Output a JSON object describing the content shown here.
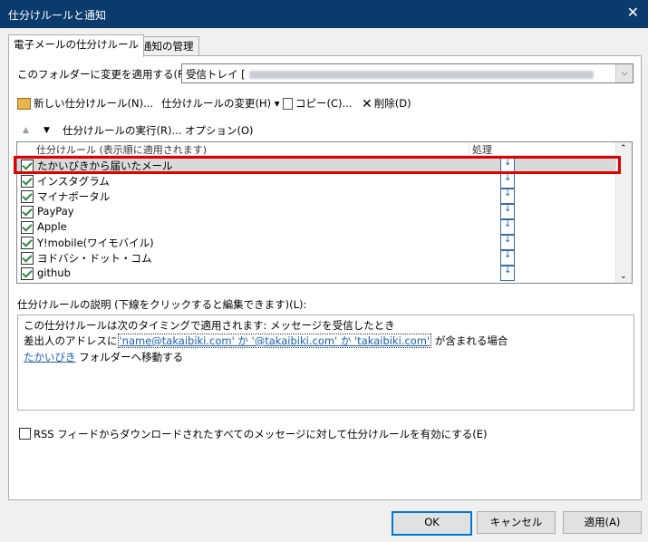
{
  "window": {
    "title": "仕分けルールと通知",
    "close_glyph": "✕"
  },
  "tabs": [
    {
      "label": "電子メールの仕分けルール"
    },
    {
      "label": "通知の管理"
    }
  ],
  "apply_to": {
    "label": "このフォルダーに変更を適用する(F):",
    "value": "受信トレイ [",
    "dropdown_glyph": "⌵"
  },
  "toolbar": {
    "new_rule": "新しい仕分けルール(N)...",
    "change_rule": "仕分けルールの変更(H)",
    "change_rule_glyph": "▾",
    "copy": "コピー(C)...",
    "delete": "削除(D)",
    "up_glyph": "▲",
    "down_glyph": "▼",
    "run_rules": "仕分けルールの実行(R)...",
    "options": "オプション(O)"
  },
  "rules_list": {
    "col_rule": "仕分けルール (表示順に適用されます)",
    "col_action": "処理",
    "rows": [
      {
        "name": "たかいびきから届いたメール"
      },
      {
        "name": "インスタグラム"
      },
      {
        "name": "マイナポータル"
      },
      {
        "name": "PayPay"
      },
      {
        "name": "Apple"
      },
      {
        "name": "Y!mobile(ワイモバイル)"
      },
      {
        "name": "ヨドバシ・ドット・コム"
      },
      {
        "name": "github"
      }
    ],
    "scroll_up_glyph": "⌃",
    "scroll_down_glyph": "⌄"
  },
  "description": {
    "label": "仕分けルールの説明 (下線をクリックすると編集できます)(L):",
    "line1": "この仕分けルールは次のタイミングで適用されます: メッセージを受信したとき",
    "line2_prefix": "差出人のアドレスに",
    "line2_link": "'name@takaibiki.com' か '@takaibiki.com' か 'takaibiki.com'",
    "line2_suffix": "が含まれる場合",
    "line3_link": "たかいびき",
    "line3_suffix": "フォルダーへ移動する"
  },
  "rss_option": {
    "label": "RSS フィードからダウンロードされたすべてのメッセージに対して仕分けルールを有効にする(E)"
  },
  "buttons": {
    "ok": "OK",
    "cancel": "キャンセル",
    "apply": "適用(A)"
  }
}
